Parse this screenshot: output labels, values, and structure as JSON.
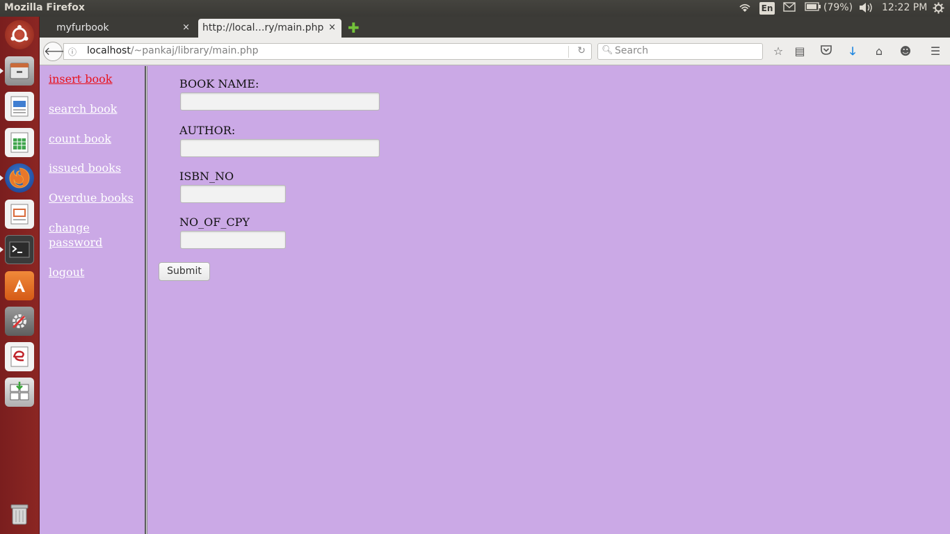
{
  "panel": {
    "app_title": "Mozilla Firefox",
    "keyboard": "En",
    "battery": "(79%)",
    "clock": "12:22 PM"
  },
  "tabs": [
    {
      "label": "myfurbook",
      "close": "×"
    },
    {
      "label": "http://local…ry/main.php",
      "close": "×"
    }
  ],
  "urlbar": {
    "host": "localhost",
    "path": "/~pankaj/library/main.php"
  },
  "search": {
    "placeholder": "Search"
  },
  "menu": {
    "items": [
      {
        "label": "insert book",
        "current": true
      },
      {
        "label": "search book"
      },
      {
        "label": "count book"
      },
      {
        "label": "issued books"
      },
      {
        "label": "Overdue books"
      },
      {
        "label": "change password"
      },
      {
        "label": "logout"
      }
    ]
  },
  "form": {
    "book_name_label": "BOOK NAME:",
    "author_label": "AUTHOR:",
    "isbn_label": "ISBN_NO",
    "copies_label": "NO_OF_CPY",
    "submit_label": "Submit",
    "book_name_value": "",
    "author_value": "",
    "isbn_value": "",
    "copies_value": ""
  },
  "colors": {
    "page_background": "#cba9e6",
    "current_link": "#e8121d",
    "link": "#ffffff"
  }
}
